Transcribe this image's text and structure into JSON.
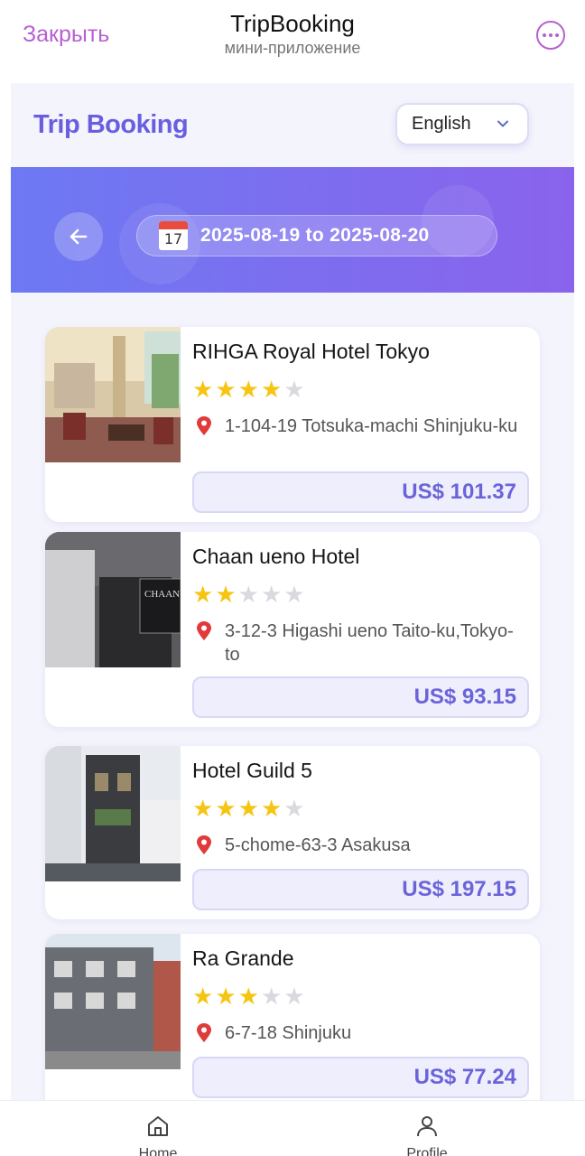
{
  "miniapp": {
    "close_label": "Закрыть",
    "title": "TripBooking",
    "subtitle": "мини-приложение",
    "more_icon": "more-dots-icon"
  },
  "header": {
    "brand": "Trip Booking",
    "language": "English"
  },
  "search": {
    "calendar_day": "17",
    "date_range": "2025-08-19 to 2025-08-20"
  },
  "hotels": [
    {
      "name": "RIHGA Royal Hotel Tokyo",
      "stars": 4,
      "address": "1-104-19 Totsuka-machi Shinjuku-ku",
      "price": "US$ 101.37"
    },
    {
      "name": "Chaan ueno Hotel",
      "stars": 2,
      "address": "3-12-3 Higashi ueno Taito-ku,Tokyo-to",
      "price": "US$ 93.15",
      "sign_text": "CHAAN HOTEL UENO"
    },
    {
      "name": "Hotel Guild 5",
      "stars": 4,
      "address": "5-chome-63-3 Asakusa",
      "price": "US$ 197.15"
    },
    {
      "name": "Ra Grande",
      "stars": 3,
      "address": "6-7-18 Shinjuku",
      "price": "US$ 77.24"
    }
  ],
  "nav": {
    "home": "Home",
    "profile": "Profile"
  },
  "colors": {
    "accent": "#6a5ee0",
    "close_link": "#b85fd0",
    "star_on": "#f6c511",
    "star_off": "#d9d9df",
    "hero_start": "#6d79f2",
    "hero_end": "#8a63ec"
  }
}
